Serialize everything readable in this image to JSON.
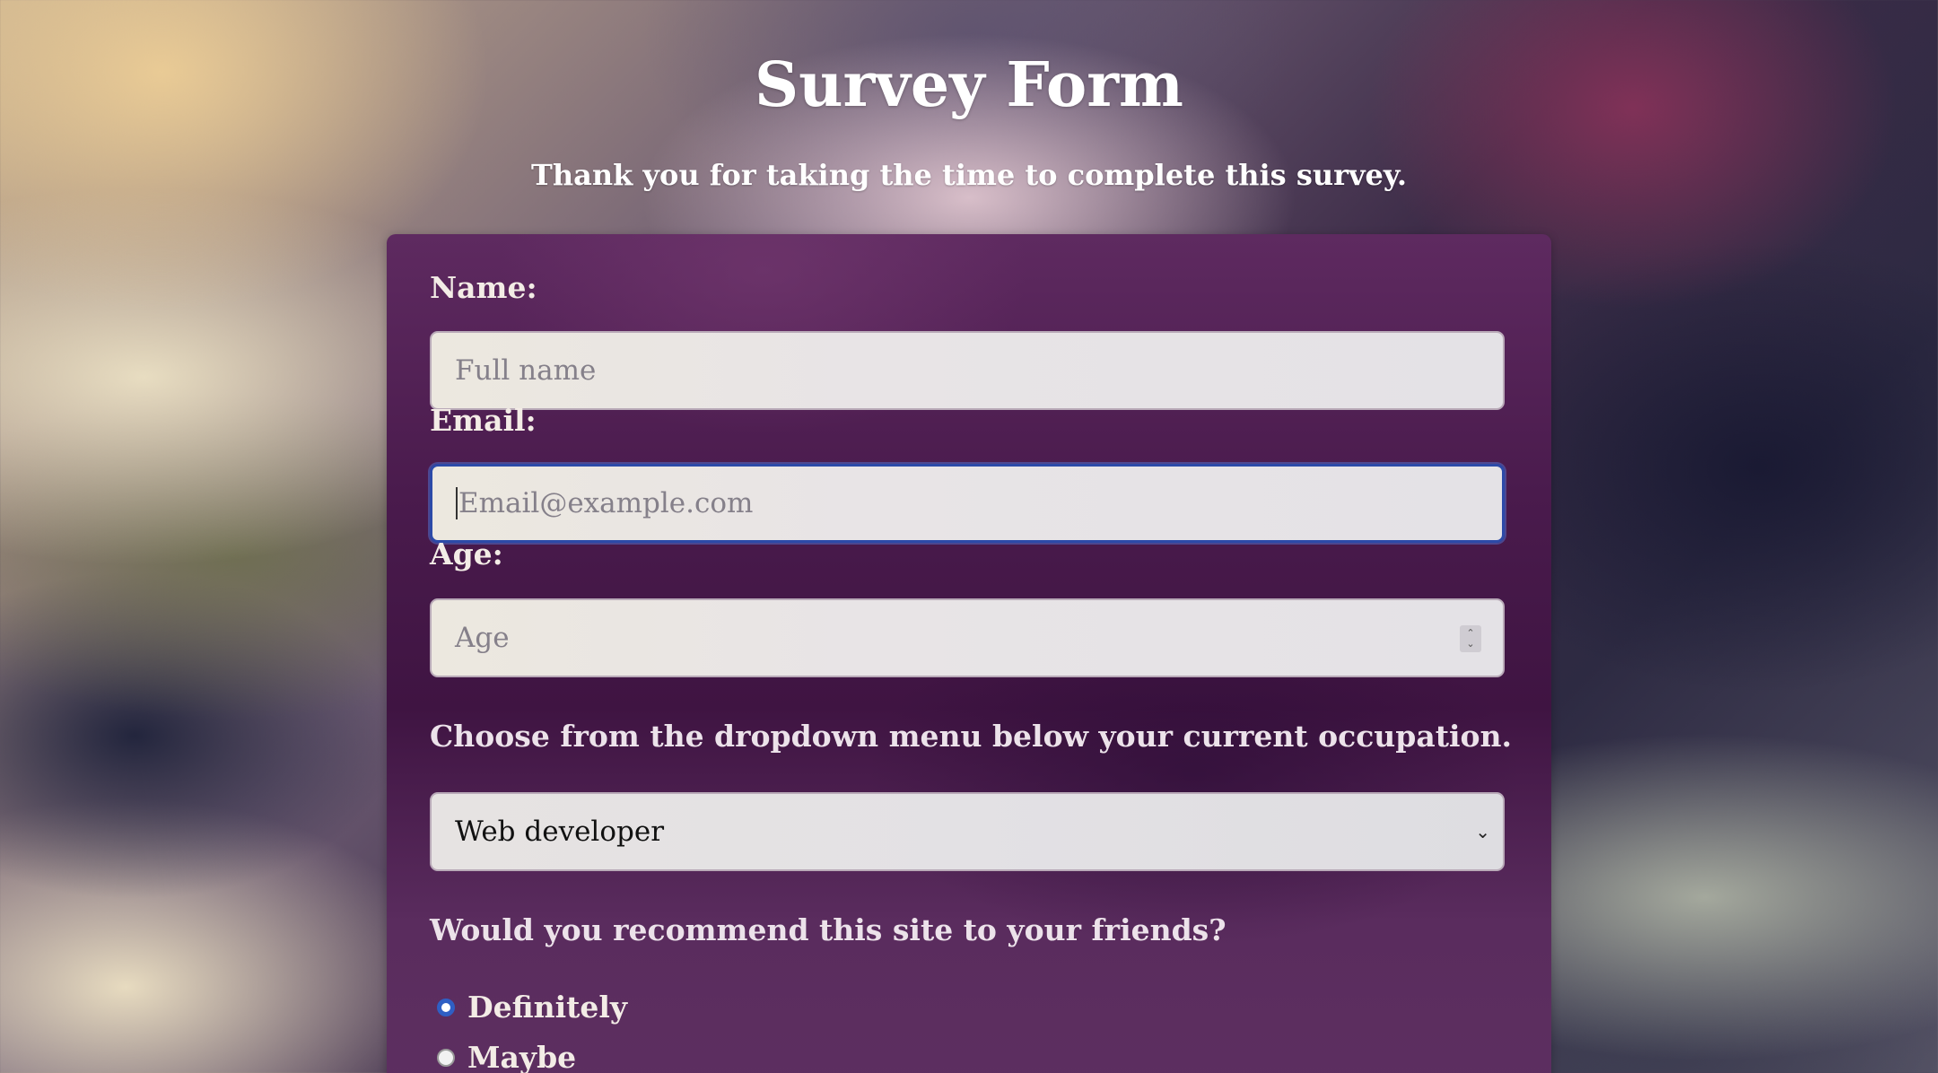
{
  "page": {
    "title": "Survey Form",
    "description": "Thank you for taking the time to complete this survey."
  },
  "form": {
    "name": {
      "label": "Name:",
      "placeholder": "Full name",
      "value": ""
    },
    "email": {
      "label": "Email:",
      "placeholder": "Email@example.com",
      "value": "",
      "focused": true
    },
    "age": {
      "label": "Age:",
      "placeholder": "Age",
      "value": ""
    },
    "occupation": {
      "prompt": "Choose from the dropdown menu below your current occupation.",
      "selected": "Web developer"
    },
    "recommend": {
      "question": "Would you recommend this site to your friends?",
      "options": [
        {
          "label": "Definitely",
          "checked": true
        },
        {
          "label": "Maybe",
          "checked": false
        }
      ]
    }
  },
  "colors": {
    "card_background": "#4a1b4d",
    "focus_ring": "#2c4aa8",
    "radio_checked": "#2f5fc4"
  },
  "icons": {
    "select_arrow": "chevron-down-icon",
    "age_spinner": "spinner-arrows-icon"
  }
}
